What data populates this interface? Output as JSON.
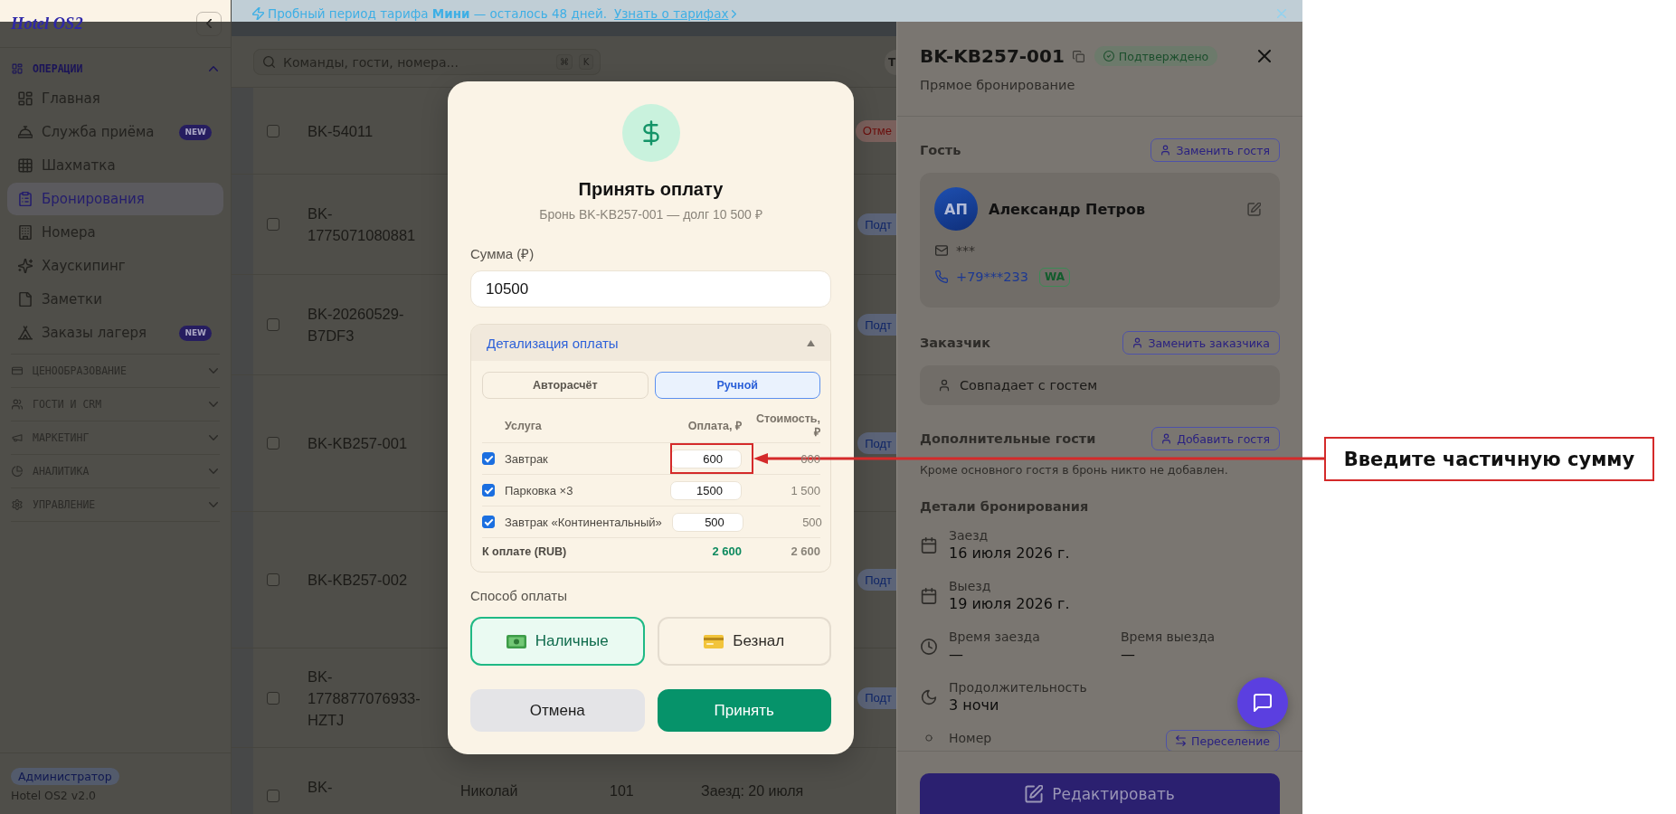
{
  "sidebar": {
    "logo": "Hotel OS2",
    "sections": [
      {
        "label": "ОПЕРАЦИИ",
        "expanded": true,
        "items": [
          {
            "label": "Главная",
            "selected": false
          },
          {
            "label": "Служба приёма",
            "selected": false,
            "badge": "NEW"
          },
          {
            "label": "Шахматка",
            "selected": false
          },
          {
            "label": "Бронирования",
            "selected": true
          },
          {
            "label": "Номера",
            "selected": false
          },
          {
            "label": "Хаускипинг",
            "selected": false
          },
          {
            "label": "Заметки",
            "selected": false
          },
          {
            "label": "Заказы лагеря",
            "selected": false,
            "badge": "NEW"
          }
        ]
      },
      {
        "label": "ЦЕНООБРАЗОВАНИЕ",
        "expanded": false
      },
      {
        "label": "ГОСТИ И CRM",
        "expanded": false
      },
      {
        "label": "МАРКЕТИНГ",
        "expanded": false
      },
      {
        "label": "АНАЛИТИКА",
        "expanded": false
      },
      {
        "label": "УПРАВЛЕНИЕ",
        "expanded": false
      }
    ],
    "role": "Администратор",
    "version": "Hotel OS2 v2.0"
  },
  "banner": {
    "text": "Пробный период тарифа **Мини** — осталось 48 дней.",
    "link": "Узнать о тарифах"
  },
  "header": {
    "search": {
      "placeholder": "Команды, гости, номера..."
    },
    "shortcut_keys": [
      "⌘",
      "K"
    ],
    "user_initials": "Т"
  },
  "bookings": {
    "rows": [
      {
        "checked": false,
        "id": "BK-54011",
        "status": {
          "text": "Отме",
          "kind": "cancelled"
        }
      },
      {
        "checked": false,
        "id": "BK-1775071080881",
        "status": {
          "text": "Подт",
          "kind": "confirmed"
        }
      },
      {
        "checked": false,
        "id": "BK-20260529-B7DF3",
        "status": {
          "text": "Подт",
          "kind": "confirmed"
        }
      },
      {
        "checked": false,
        "id": "BK-KB257-001",
        "status": {
          "text": "Подт",
          "kind": "confirmed"
        }
      },
      {
        "checked": false,
        "id": "BK-KB257-002",
        "status": {
          "text": "Подт",
          "kind": "confirmed"
        }
      },
      {
        "checked": false,
        "id": "BK-1778877076933-HZTJ",
        "status": {
          "text": "Подт",
          "kind": "confirmed"
        }
      },
      {
        "checked": false,
        "id": "BK-",
        "guest": "Николай",
        "room": "101",
        "dates": "Заезд: 20 июля"
      }
    ]
  },
  "payment_dialog": {
    "title": "Принять оплату",
    "subtitle": "Бронь BK-KB257-001 — долг 10 500 ₽",
    "amount": {
      "label": "Сумма (₽)",
      "value": "10500"
    },
    "details": {
      "title": "Детализация оплаты",
      "expanded": true,
      "modes": [
        {
          "label": "Авторасчёт",
          "selected": false
        },
        {
          "label": "Ручной",
          "selected": true
        }
      ],
      "columns": [
        "Услуга",
        "Оплата, ₽",
        "Стоимость, ₽"
      ],
      "rows": [
        {
          "checked": true,
          "service": "Завтрак",
          "payment": "600",
          "cost": "600"
        },
        {
          "checked": true,
          "service": "Парковка ×3",
          "payment": "1500",
          "cost": "1 500"
        },
        {
          "checked": true,
          "service": "Завтрак «Континентальный»",
          "payment": "500",
          "cost": "500"
        }
      ],
      "total": {
        "label": "К оплате (RUB)",
        "payment": "2 600",
        "cost": "2 600"
      }
    },
    "method_label": "Способ оплаты",
    "methods": [
      {
        "label": "Наличные",
        "kind": "cash",
        "selected": true
      },
      {
        "label": "Безнал",
        "kind": "card",
        "selected": false
      }
    ],
    "buttons": [
      {
        "label": "Отмена",
        "kind": "secondary"
      },
      {
        "label": "Принять",
        "kind": "primary"
      }
    ]
  },
  "booking_panel": {
    "title": "BK-KB257-001",
    "status": "Подтверждено",
    "source": "Прямое бронирование",
    "guest_section": {
      "title": "Гость",
      "action": "Заменить гостя"
    },
    "guest": {
      "initials": "АП",
      "name": "Александр Петров",
      "email": "***",
      "phone": "+79***233",
      "messenger": "WA"
    },
    "customer": {
      "title": "Заказчик",
      "action": "Заменить заказчика",
      "value": "Совпадает с гостем"
    },
    "extra_guests": {
      "title": "Дополнительные гости",
      "action": "Добавить гостя",
      "note": "Кроме основного гостя в бронь никто не добавлен."
    },
    "details": {
      "title": "Детали бронирования",
      "fields": [
        {
          "kind": "date",
          "columns": [
            {
              "label": "Заезд",
              "value": "16 июля 2026 г."
            }
          ]
        },
        {
          "kind": "date",
          "columns": [
            {
              "label": "Выезд",
              "value": "19 июля 2026 г."
            }
          ]
        },
        {
          "kind": "time",
          "columns": [
            {
              "label": "Время заезда",
              "value": "—"
            },
            {
              "label": "Время выезда",
              "value": "—"
            }
          ]
        },
        {
          "kind": "duration",
          "columns": [
            {
              "label": "Продолжительность",
              "value": "3 ночи"
            }
          ]
        },
        {
          "kind": "room",
          "columns": [
            {
              "label": "Номер"
            }
          ],
          "action": "Переселение"
        }
      ]
    },
    "edit_button": "Редактировать"
  },
  "annotation": {
    "text": "Введите частичную сумму"
  }
}
